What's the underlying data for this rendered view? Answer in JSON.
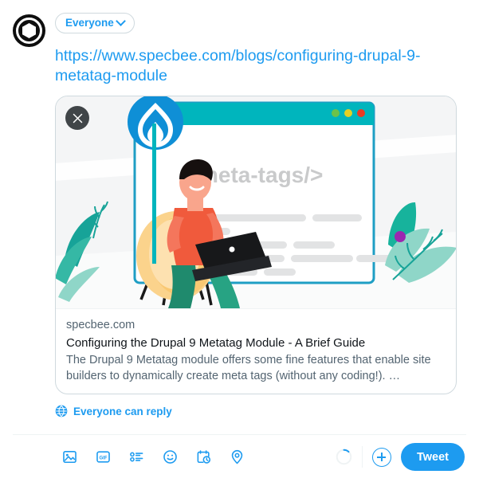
{
  "composer": {
    "avatar_label": "profile-avatar",
    "audience": {
      "label": "Everyone",
      "chevron_icon": "chevron-down-icon"
    },
    "tweet_text": "https://www.specbee.com/blogs/configuring-drupal-9-metatag-module",
    "link_card": {
      "close_icon": "close-icon",
      "image_alt": "meta-tags illustration",
      "image": {
        "code_text": "<meta-tags/>",
        "drupal_logo": "drupal-logo-icon",
        "window_dots": [
          "#6cc24a",
          "#e3d024",
          "#ec3b23"
        ],
        "window_bar_color": "#00b5bd",
        "accent_purple": "#9c27b0"
      },
      "domain": "specbee.com",
      "title": "Configuring the Drupal 9 Metatag Module - A Brief Guide",
      "description": "The Drupal 9 Metatag module offers some fine features that enable site builders to dynamically create meta tags (without any coding!). …"
    },
    "reply_scope": {
      "icon": "globe-icon",
      "label": "Everyone can reply"
    },
    "toolbar": {
      "icons": [
        {
          "name": "media-icon",
          "title": "Media"
        },
        {
          "name": "gif-icon",
          "title": "GIF"
        },
        {
          "name": "poll-icon",
          "title": "Poll"
        },
        {
          "name": "emoji-icon",
          "title": "Emoji"
        },
        {
          "name": "schedule-icon",
          "title": "Schedule"
        },
        {
          "name": "location-icon",
          "title": "Location"
        }
      ],
      "gif_label": "GIF",
      "char_progress_percent": 12,
      "add_button_icon": "plus-icon",
      "tweet_label": "Tweet"
    },
    "colors": {
      "accent": "#1d9bf0",
      "text_primary": "#0f1419",
      "text_secondary": "#536471",
      "border": "#cfd9de"
    }
  }
}
